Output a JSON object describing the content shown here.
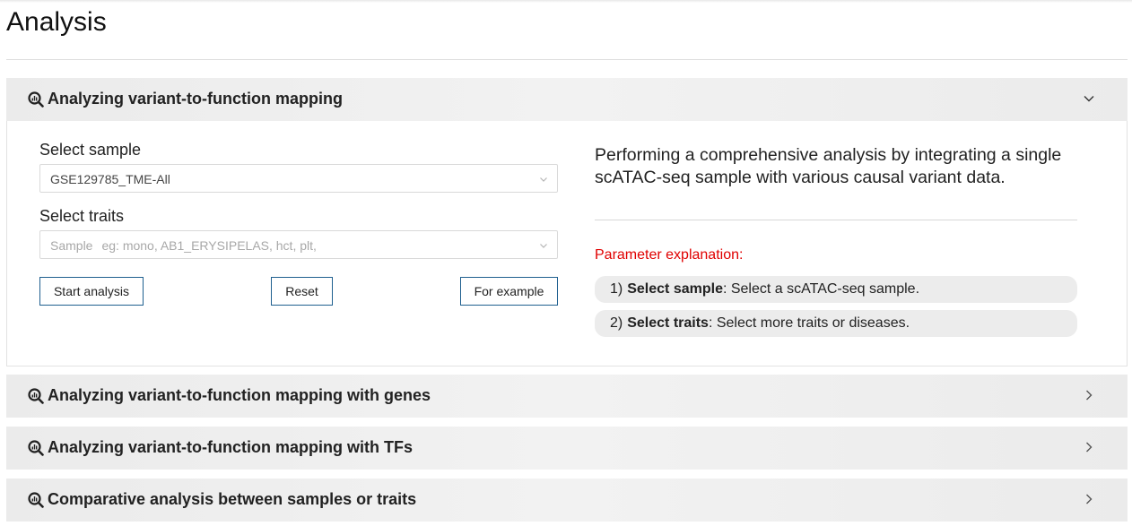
{
  "page": {
    "title": "Analysis"
  },
  "panels": [
    {
      "title": "Analyzing variant-to-function mapping",
      "expanded": true,
      "icon": "search-analytics-icon"
    },
    {
      "title": "Analyzing variant-to-function mapping with genes",
      "expanded": false,
      "icon": "search-analytics-icon"
    },
    {
      "title": "Analyzing variant-to-function mapping with TFs",
      "expanded": false,
      "icon": "search-analytics-icon"
    },
    {
      "title": "Comparative analysis between samples or traits",
      "expanded": false,
      "icon": "search-analytics-icon"
    }
  ],
  "form": {
    "sample_label": "Select sample",
    "sample_value": "GSE129785_TME-All",
    "traits_label": "Select traits",
    "traits_placeholder_prefix": "Sample",
    "traits_placeholder": "eg: mono, AB1_ERYSIPELAS, hct, plt,",
    "buttons": {
      "start": "Start analysis",
      "reset": "Reset",
      "example": "For example"
    }
  },
  "info": {
    "description": "Performing a comprehensive analysis by integrating a single scATAC-seq sample with various causal variant data.",
    "param_title": "Parameter explanation:",
    "params": [
      {
        "num": "1)",
        "name": "Select sample",
        "text": ": Select a scATAC-seq sample."
      },
      {
        "num": "2)",
        "name": "Select traits",
        "text": ": Select more traits or diseases."
      }
    ]
  },
  "colors": {
    "button_border": "#1f5f8f",
    "param_title": "#e00000",
    "header_bg": "#ebebeb"
  }
}
